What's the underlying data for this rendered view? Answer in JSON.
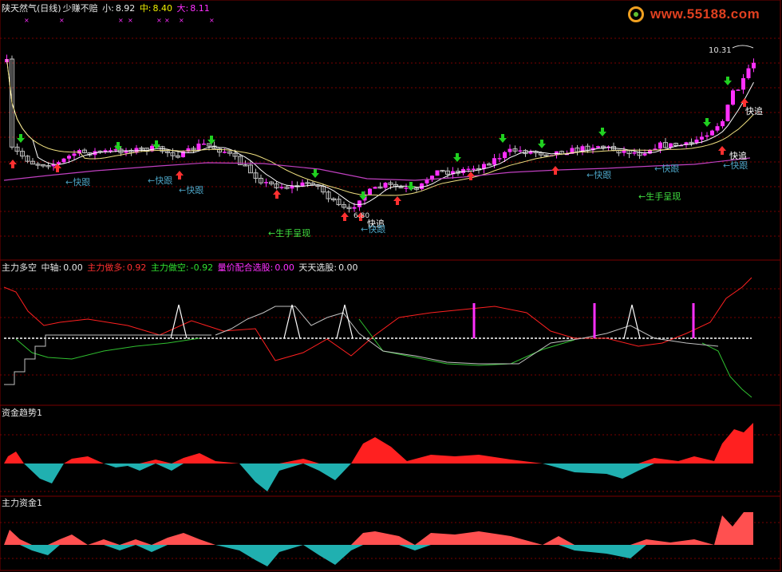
{
  "panel_main": {
    "title": "陕天然气(日线)",
    "indicator": "少赚不赔",
    "small_label": "小:",
    "small_value": "8.92",
    "mid_label": "中:",
    "mid_value": "8.40",
    "big_label": "大:",
    "big_value": "8.11",
    "high_price": "10.31",
    "low_price": "6.80",
    "annotations": [
      "←快跟",
      "←快跟",
      "←快跟",
      "快追",
      "←快跟",
      "←生手呈现",
      "←快跟",
      "←快跟",
      "←生手呈现",
      "快追",
      "←快跟",
      "快追"
    ]
  },
  "panel_indicator": {
    "name": "主力多空",
    "axis_label": "中轴:",
    "axis_value": "0.00",
    "long_label": "主力做多:",
    "long_value": "0.92",
    "short_label": "主力做空:",
    "short_value": "-0.92",
    "vol_label": "量价配合选股:",
    "vol_value": "0.00",
    "daily_label": "天天选股:",
    "daily_value": "0.00"
  },
  "panel_trend": {
    "name": "资金趋势1"
  },
  "panel_money": {
    "name": "主力资金1"
  },
  "logo": {
    "text": "www.55188.com"
  },
  "colors": {
    "up": "#ff30ff",
    "down": "#c0c0c0",
    "red": "#ff2020",
    "cyan": "#20b0b0",
    "money_red": "#ff5050",
    "grid": "#7a0000",
    "ma_white": "#ffffff",
    "ma_yellow": "#f0e080",
    "ma_purple": "#c040c0",
    "signal_green": "#20d020",
    "signal_red": "#ff3030"
  }
}
